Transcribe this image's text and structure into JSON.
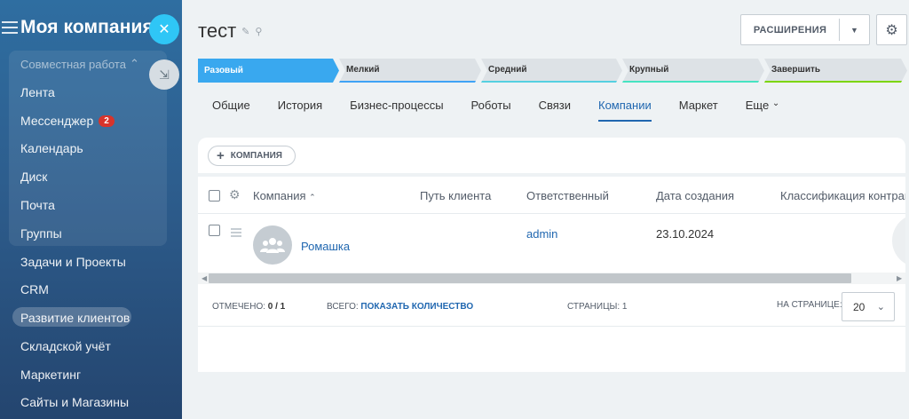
{
  "sidebar": {
    "company_name": "Моя компания",
    "group_title": "Совместная работа",
    "items": [
      {
        "label": "Лента"
      },
      {
        "label": "Мессенджер",
        "badge": "2"
      },
      {
        "label": "Календарь"
      },
      {
        "label": "Диск"
      },
      {
        "label": "Почта"
      },
      {
        "label": "Группы"
      },
      {
        "label": "Задачи и Проекты"
      },
      {
        "label": "CRM"
      },
      {
        "label": "Развитие клиентов"
      },
      {
        "label": "Складской учёт"
      },
      {
        "label": "Маркетинг"
      },
      {
        "label": "Сайты и Магазины"
      }
    ]
  },
  "header": {
    "title": "тест",
    "extensions_label": "РАСШИРЕНИЯ"
  },
  "stages": [
    {
      "label": "Разовый",
      "status": "active"
    },
    {
      "label": "Мелкий"
    },
    {
      "label": "Средний"
    },
    {
      "label": "Крупный"
    },
    {
      "label": "Завершить"
    }
  ],
  "tabs": [
    {
      "label": "Общие"
    },
    {
      "label": "История"
    },
    {
      "label": "Бизнес-процессы"
    },
    {
      "label": "Роботы"
    },
    {
      "label": "Связи"
    },
    {
      "label": "Компании",
      "active": true
    },
    {
      "label": "Маркет"
    },
    {
      "label": "Еще"
    }
  ],
  "add_company_label": "КОМПАНИЯ",
  "grid": {
    "columns": [
      "Компания",
      "Путь клиента",
      "Ответственный",
      "Дата создания",
      "Классификация контрагента"
    ],
    "rows": [
      {
        "company": "Ромашка",
        "path": "",
        "responsible": "admin",
        "created": "23.10.2024"
      }
    ]
  },
  "footer": {
    "selected_label": "ОТМЕЧЕНО:",
    "selected_value": "0 / 1",
    "total_label": "ВСЕГО:",
    "total_link": "ПОКАЗАТЬ КОЛИЧЕСТВО",
    "pages_label": "СТРАНИЦЫ:",
    "pages_value": "1",
    "per_page_label": "НА СТРАНИЦЕ:",
    "per_page_value": "20"
  },
  "colors": {
    "accent": "#39a8ef",
    "link": "#2067b0",
    "close_button": "#2fc6f6",
    "badge": "#d8342b"
  }
}
